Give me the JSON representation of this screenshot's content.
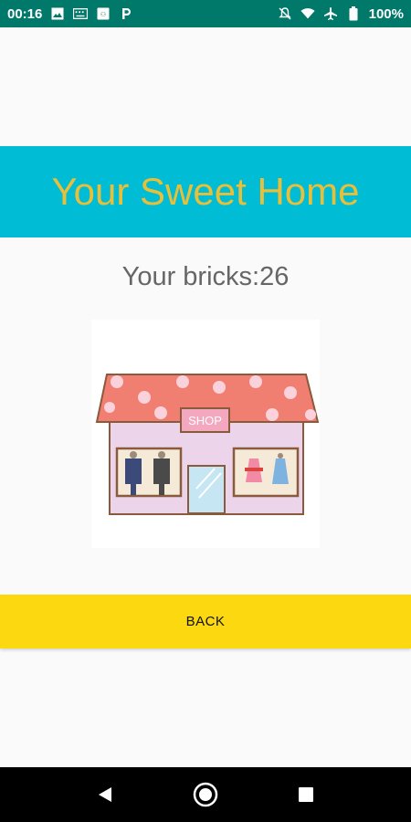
{
  "status_bar": {
    "time": "00:16",
    "battery": "100%",
    "left_icons": [
      "image-icon",
      "keyboard-icon",
      "sim-icon",
      "parking-icon"
    ],
    "right_icons": [
      "mute-icon",
      "wifi-icon",
      "airplane-icon",
      "battery-icon"
    ]
  },
  "main": {
    "title": "Your Sweet Home",
    "bricks_text": "Your bricks:26",
    "back_label": "BACK",
    "shop_sign": "SHOP"
  },
  "colors": {
    "status_bar": "#00796b",
    "banner": "#00bcd4",
    "title_text": "#e9bf3a",
    "back_button": "#fbd80f"
  },
  "nav_bar": {
    "buttons": [
      "back-nav-icon",
      "home-nav-icon",
      "recents-nav-icon"
    ]
  }
}
